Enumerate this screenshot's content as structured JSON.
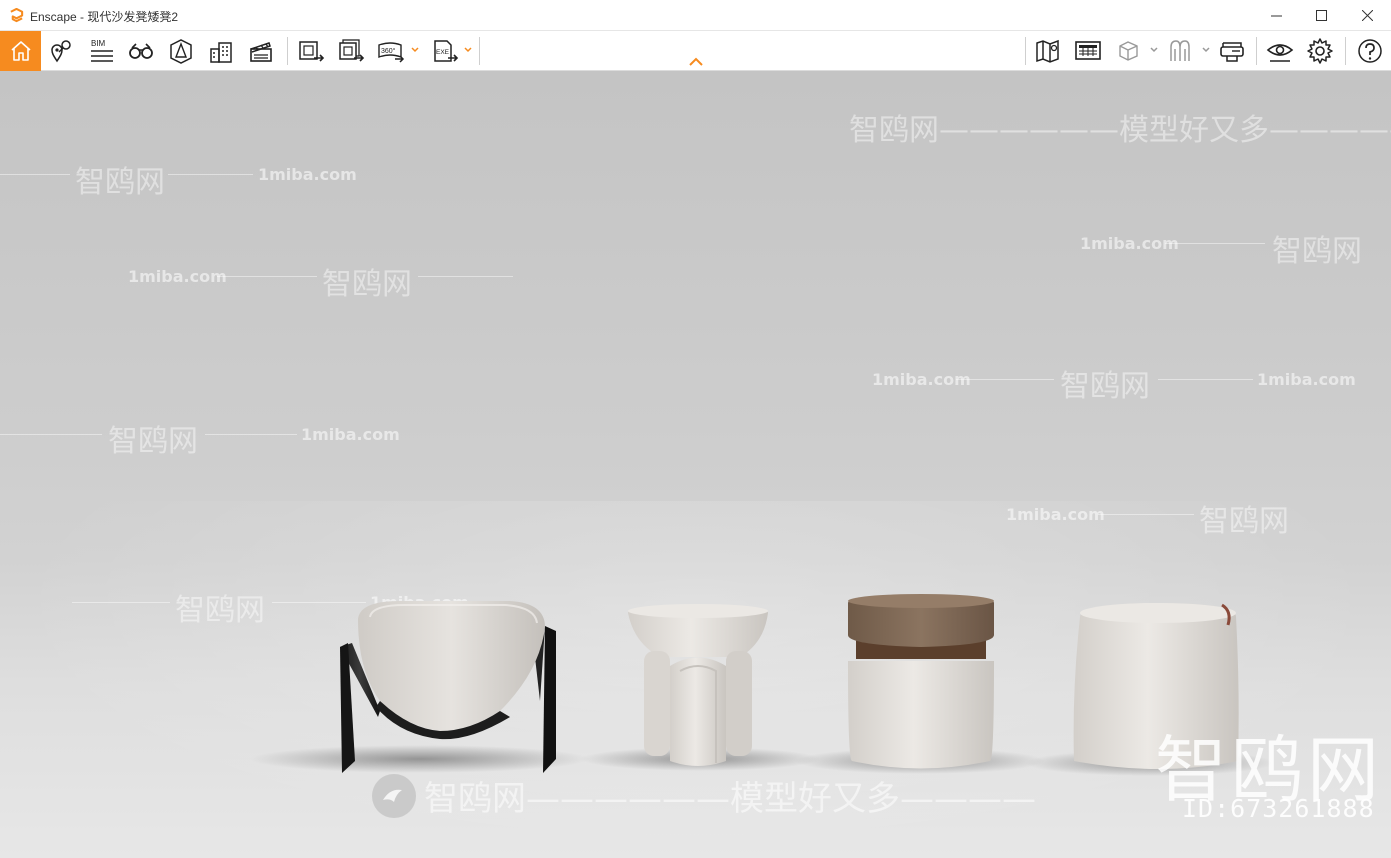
{
  "window": {
    "title": "Enscape - 现代沙发凳矮凳2",
    "minimize_icon": "minimize-icon",
    "maximize_icon": "maximize-icon",
    "close_icon": "close-icon"
  },
  "toolbar": {
    "left_tools": [
      {
        "name": "home",
        "icon": "home-icon"
      },
      {
        "name": "views",
        "icon": "location-pin-icon"
      },
      {
        "name": "bim",
        "label": "BIM",
        "icon": "bim-list-icon"
      },
      {
        "name": "binoculars",
        "icon": "binoculars-icon"
      },
      {
        "name": "orthographic",
        "icon": "perspective-icon"
      },
      {
        "name": "buildings",
        "icon": "buildings-icon"
      },
      {
        "name": "video-editor",
        "icon": "clapperboard-icon"
      },
      {
        "name": "export-image",
        "icon": "export-image-icon"
      },
      {
        "name": "batch-export",
        "icon": "batch-export-icon"
      },
      {
        "name": "panorama",
        "label": "360°",
        "icon": "panorama-360-icon"
      },
      {
        "name": "exe-export",
        "label": "EXE",
        "icon": "exe-export-icon"
      }
    ],
    "right_tools": [
      {
        "name": "map",
        "icon": "map-icon"
      },
      {
        "name": "presentation",
        "icon": "presentation-icon"
      },
      {
        "name": "cube",
        "icon": "cube-icon"
      },
      {
        "name": "asset-library",
        "icon": "asset-library-icon"
      },
      {
        "name": "vr-headset",
        "icon": "vr-headset-icon"
      },
      {
        "name": "visual-settings",
        "icon": "eye-icon"
      },
      {
        "name": "settings",
        "icon": "gear-icon"
      },
      {
        "name": "help",
        "icon": "help-icon"
      }
    ],
    "collapse_icon": "chevron-up-icon",
    "accent_color": "#f68b1f"
  },
  "watermarks": {
    "site": "1miba.com",
    "brand": "智鸥网",
    "slogan": "模型好又多",
    "brand_large": "智鸥网",
    "id_text": "ID:673261888",
    "bottom_line": "智鸥网——————模型好又多————",
    "top_line": "智鸥网——————模型好又多——————",
    "dash": "——————"
  }
}
